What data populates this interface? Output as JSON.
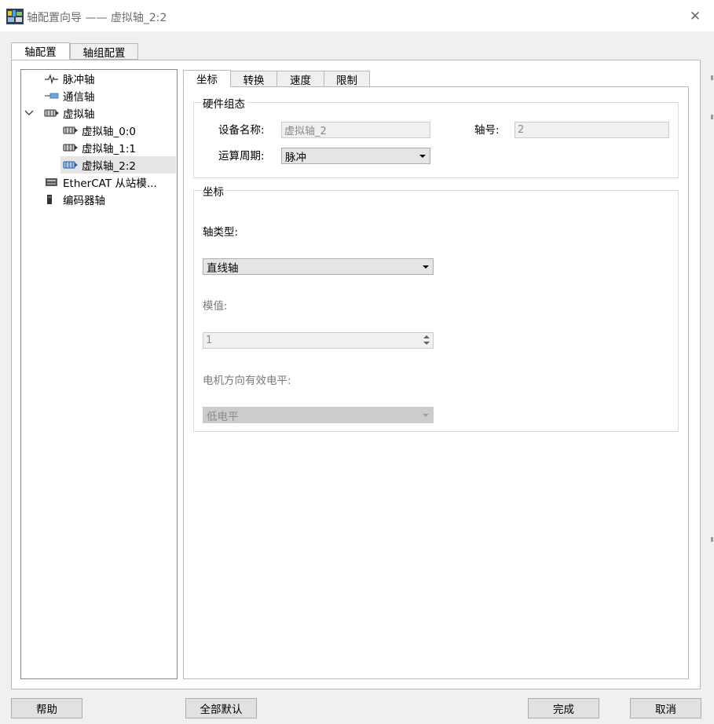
{
  "window": {
    "title": "轴配置向导 —— 虚拟轴_2:2",
    "close_glyph": "✕"
  },
  "top_tabs": [
    {
      "label": "轴配置",
      "active": true
    },
    {
      "label": "轴组配置",
      "active": false
    }
  ],
  "tree": {
    "items": [
      {
        "label": "脉冲轴",
        "icon": "pulse-axis-icon"
      },
      {
        "label": "通信轴",
        "icon": "comm-axis-icon"
      },
      {
        "label": "虚拟轴",
        "icon": "virtual-axis-icon",
        "expanded": true
      },
      {
        "label": "虚拟轴_0:0",
        "icon": "virtual-axis-icon"
      },
      {
        "label": "虚拟轴_1:1",
        "icon": "virtual-axis-icon"
      },
      {
        "label": "虚拟轴_2:2",
        "icon": "virtual-axis-icon",
        "selected": true
      },
      {
        "label": "EtherCAT 从站模...",
        "icon": "ethercat-slave-icon"
      },
      {
        "label": "编码器轴",
        "icon": "encoder-axis-icon"
      }
    ]
  },
  "inner_tabs": [
    {
      "label": "坐标",
      "active": true
    },
    {
      "label": "转换",
      "active": false
    },
    {
      "label": "速度",
      "active": false
    },
    {
      "label": "限制",
      "active": false
    }
  ],
  "hardware_group": {
    "title": "硬件组态",
    "device_name_label": "设备名称:",
    "device_name_value": "虚拟轴_2",
    "axis_no_label": "轴号:",
    "axis_no_value": "2",
    "cycle_label": "运算周期:",
    "cycle_value": "脉冲"
  },
  "coord_group": {
    "title": "坐标",
    "axis_type_label": "轴类型:",
    "axis_type_value": "直线轴",
    "modulo_label": "模值:",
    "modulo_value": "1",
    "motor_dir_label": "电机方向有效电平:",
    "motor_dir_value": "低电平"
  },
  "buttons": {
    "help": "帮助",
    "defaults": "全部默认",
    "finish": "完成",
    "cancel": "取消"
  },
  "colors": {
    "window_bg": "#f0f0f0",
    "panel_bg": "#ffffff",
    "selection": "#e5e5e5",
    "disabled_text": "#8a8a8a"
  }
}
